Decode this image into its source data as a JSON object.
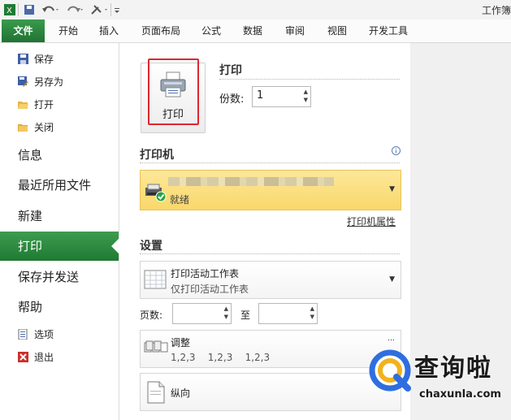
{
  "titlebar": {
    "title": "工作簿"
  },
  "tabs": {
    "file": "文件",
    "home": "开始",
    "insert": "插入",
    "page_layout": "页面布局",
    "formulas": "公式",
    "data": "数据",
    "review": "审阅",
    "view": "视图",
    "developer": "开发工具"
  },
  "nav": {
    "save": "保存",
    "save_as": "另存为",
    "open": "打开",
    "close": "关闭",
    "info": "信息",
    "recent": "最近所用文件",
    "new": "新建",
    "print": "打印",
    "save_send": "保存并发送",
    "help": "帮助",
    "options": "选项",
    "exit": "退出"
  },
  "print": {
    "button_label": "打印",
    "heading": "打印",
    "copies_label": "份数:",
    "copies_value": "1"
  },
  "printer": {
    "heading": "打印机",
    "status": "就绪",
    "properties_link": "打印机属性"
  },
  "settings": {
    "heading": "设置",
    "scope_title": "打印活动工作表",
    "scope_desc": "仅打印活动工作表",
    "pages_label": "页数:",
    "to_label": "至",
    "collate_title": "调整",
    "collate_desc": "1,2,3    1,2,3    1,2,3",
    "orientation_title": "纵向"
  },
  "watermark": {
    "name": "查询啦",
    "domain": "chaxunla.com"
  }
}
